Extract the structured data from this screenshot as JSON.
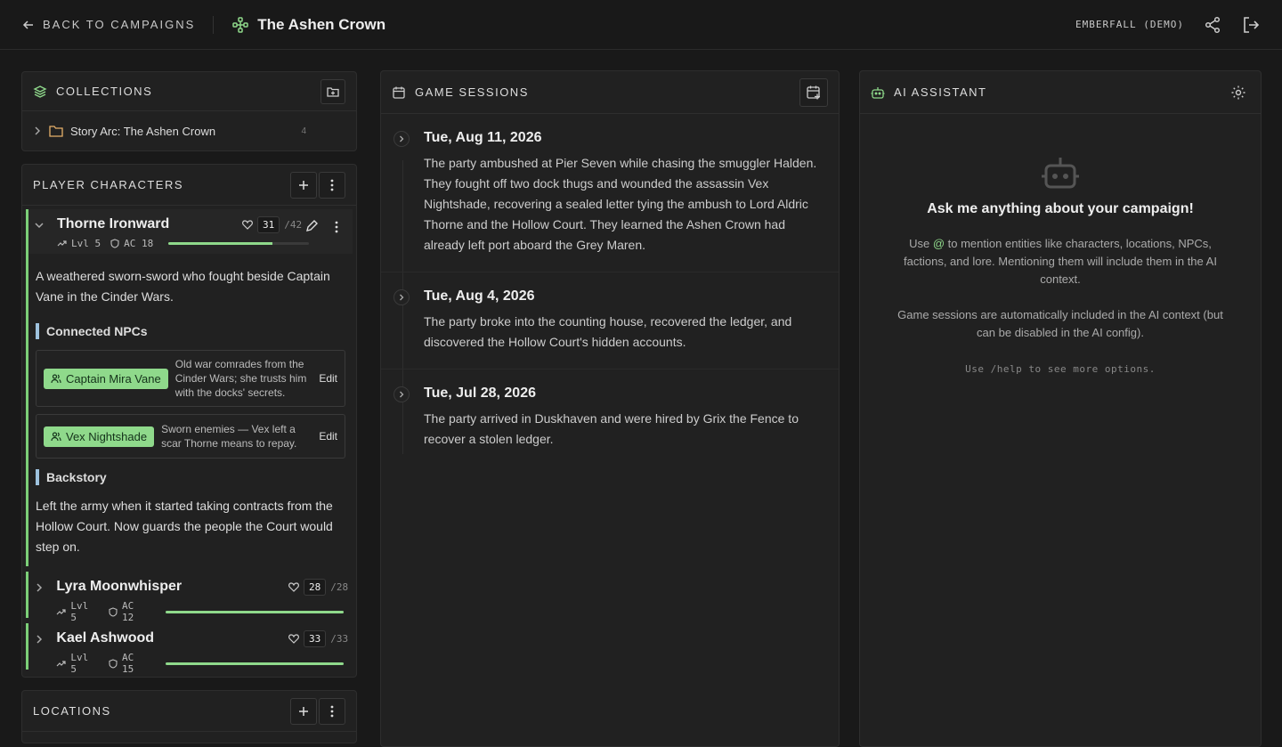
{
  "header": {
    "back_label": "BACK TO CAMPAIGNS",
    "campaign_title": "The Ashen Crown",
    "world_label": "EMBERFALL (DEMO)"
  },
  "collections": {
    "title": "COLLECTIONS",
    "items": [
      {
        "label": "Story Arc: The Ashen Crown",
        "count": "4"
      }
    ]
  },
  "player_characters": {
    "title": "PLAYER CHARACTERS",
    "characters": [
      {
        "name": "Thorne Ironward",
        "level": "Lvl 5",
        "ac": "AC 18",
        "hp": "31",
        "hp_max": "/42",
        "hp_fraction": 0.738,
        "description": "A weathered sworn-sword who fought beside Captain Vane in the Cinder Wars.",
        "connected_npcs_heading": "Connected NPCs",
        "npcs": [
          {
            "name": "Captain Mira Vane",
            "note": "Old war comrades from the Cinder Wars; she trusts him with the docks' secrets.",
            "edit_label": "Edit"
          },
          {
            "name": "Vex Nightshade",
            "note": "Sworn enemies — Vex left a scar Thorne means to repay.",
            "edit_label": "Edit"
          }
        ],
        "backstory_heading": "Backstory",
        "backstory": "Left the army when it started taking contracts from the Hollow Court. Now guards the people the Court would step on."
      },
      {
        "name": "Lyra Moonwhisper",
        "level": "Lvl 5",
        "ac": "AC 12",
        "hp": "28",
        "hp_max": "/28",
        "hp_fraction": 1.0
      },
      {
        "name": "Kael Ashwood",
        "level": "Lvl 5",
        "ac": "AC 15",
        "hp": "33",
        "hp_max": "/33",
        "hp_fraction": 1.0
      }
    ]
  },
  "locations": {
    "title": "LOCATIONS"
  },
  "game_sessions": {
    "title": "GAME SESSIONS",
    "sessions": [
      {
        "date": "Tue, Aug 11, 2026",
        "summary": "The party ambushed at Pier Seven while chasing the smuggler Halden. They fought off two dock thugs and wounded the assassin Vex Nightshade, recovering a sealed letter tying the ambush to Lord Aldric Thorne and the Hollow Court. They learned the Ashen Crown had already left port aboard the Grey Maren."
      },
      {
        "date": "Tue, Aug 4, 2026",
        "summary": "The party broke into the counting house, recovered the ledger, and discovered the Hollow Court's hidden accounts."
      },
      {
        "date": "Tue, Jul 28, 2026",
        "summary": "The party arrived in Duskhaven and were hired by Grix the Fence to recover a stolen ledger."
      }
    ]
  },
  "ai_assistant": {
    "title": "AI ASSISTANT",
    "heading": "Ask me anything about your campaign!",
    "mention_prefix": "Use ",
    "mention_symbol": "@",
    "mention_suffix": " to mention entities like characters, locations, NPCs, factions, and lore. Mentioning them will include them in the AI context.",
    "sessions_note": "Game sessions are automatically included in the AI context (but can be disabled in the AI config).",
    "help_hint": "Use /help to see more options."
  },
  "colors": {
    "accent": "#8fd98b",
    "background": "#191919",
    "panel": "#212121"
  }
}
